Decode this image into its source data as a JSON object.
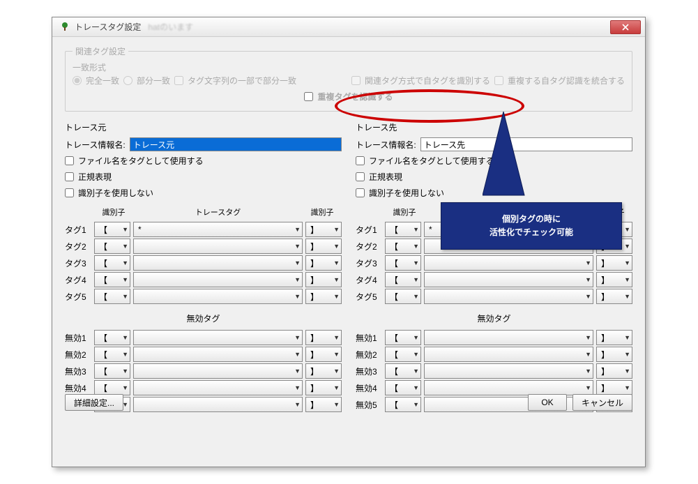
{
  "window": {
    "title": "トレースタグ設定",
    "blurred_sub": "hatのいます"
  },
  "related": {
    "legend": "関連タグ設定",
    "match_legend": "一致形式",
    "radio_full": "完全一致",
    "radio_partial": "部分一致",
    "chk_substring": "タグ文字列の一部で部分一致",
    "chk_same_row": "関連タグ方式で自タグを識別する",
    "chk_merge": "重複する自タグ認識を統合する",
    "chk_recognize_dup": "重複タグを認識する"
  },
  "panels": {
    "left": {
      "title": "トレース元",
      "info_label": "トレース情報名:",
      "info_value": "トレース元",
      "chk_filename": "ファイル名をタグとして使用する",
      "chk_regex": "正規表現",
      "chk_no_ident": "識別子を使用しない"
    },
    "right": {
      "title": "トレース先",
      "info_label": "トレース情報名:",
      "info_value": "トレース先",
      "chk_filename": "ファイル名をタグとして使用する",
      "chk_regex": "正規表現",
      "chk_no_ident": "識別子を使用しない"
    },
    "headers": {
      "id": "識別子",
      "tag": "トレースタグ",
      "id2": "識別子"
    },
    "section_invalid": "無効タグ",
    "tag_rows": [
      "タグ1",
      "タグ2",
      "タグ3",
      "タグ4",
      "タグ5"
    ],
    "id_leftmark": "【",
    "id_rightmark": "】",
    "tag_star": "*",
    "invalid_rows": [
      "無効1",
      "無効2",
      "無効3",
      "無効4",
      "無効5"
    ]
  },
  "buttons": {
    "detail": "詳細設定...",
    "ok": "OK",
    "cancel": "キャンセル"
  },
  "callout": {
    "line1": "個別タグの時に",
    "line2": "活性化でチェック可能"
  }
}
